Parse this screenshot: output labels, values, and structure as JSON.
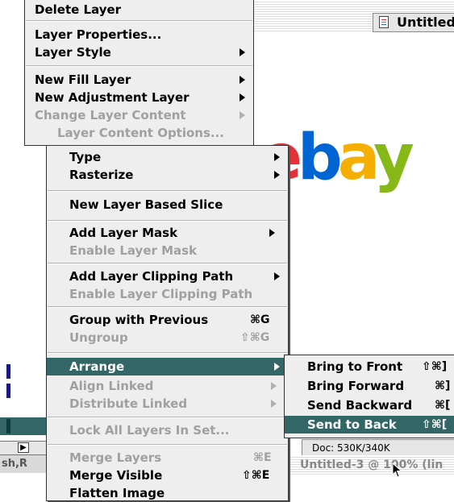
{
  "window": {
    "title": "Untitled",
    "status": "Doc: 530K/340K",
    "bottom_title": "Untitled-3 @ 100% (lin",
    "left_status": "sh,R",
    "scroll_arrow": "▶"
  },
  "colors": {
    "highlight": "#336666",
    "menu_bg": "#eeeeee",
    "disabled": "#a0a0a0"
  },
  "logo_text": "ebay",
  "layer_menu": [
    {
      "label": "Delete Layer"
    },
    {
      "label": "Layer Properties..."
    },
    {
      "label": "Layer Style",
      "submenu": true
    },
    {
      "label": "New Fill Layer",
      "submenu": true
    },
    {
      "label": "New Adjustment Layer",
      "submenu": true
    },
    {
      "label": "Change Layer Content",
      "submenu": true,
      "disabled": true
    },
    {
      "label": "Layer Content Options...",
      "disabled": true
    }
  ],
  "sub_menu": [
    {
      "label": "Type",
      "submenu": true
    },
    {
      "label": "Rasterize",
      "submenu": true
    },
    {
      "label": "New Layer Based Slice"
    },
    {
      "label": "Add Layer Mask",
      "submenu": true
    },
    {
      "label": "Enable Layer Mask",
      "disabled": true
    },
    {
      "label": "Add Layer Clipping Path",
      "submenu": true
    },
    {
      "label": "Enable Layer Clipping Path",
      "disabled": true
    },
    {
      "label": "Group with Previous",
      "shortcut": "⌘G"
    },
    {
      "label": "Ungroup",
      "shortcut": "⇧⌘G",
      "disabled": true
    },
    {
      "label": "Arrange",
      "submenu": true,
      "highlighted": true
    },
    {
      "label": "Align Linked",
      "submenu": true,
      "disabled": true
    },
    {
      "label": "Distribute Linked",
      "submenu": true,
      "disabled": true
    },
    {
      "label": "Lock All Layers In Set...",
      "disabled": true
    },
    {
      "label": "Merge Layers",
      "shortcut": "⌘E",
      "disabled": true
    },
    {
      "label": "Merge Visible",
      "shortcut": "⇧⌘E"
    },
    {
      "label": "Flatten Image"
    }
  ],
  "arrange_menu": [
    {
      "label": "Bring to Front",
      "shortcut": "⇧⌘]"
    },
    {
      "label": "Bring Forward",
      "shortcut": "⌘]"
    },
    {
      "label": "Send Backward",
      "shortcut": "⌘["
    },
    {
      "label": "Send to Back",
      "shortcut": "⇧⌘[",
      "highlighted": true
    }
  ]
}
